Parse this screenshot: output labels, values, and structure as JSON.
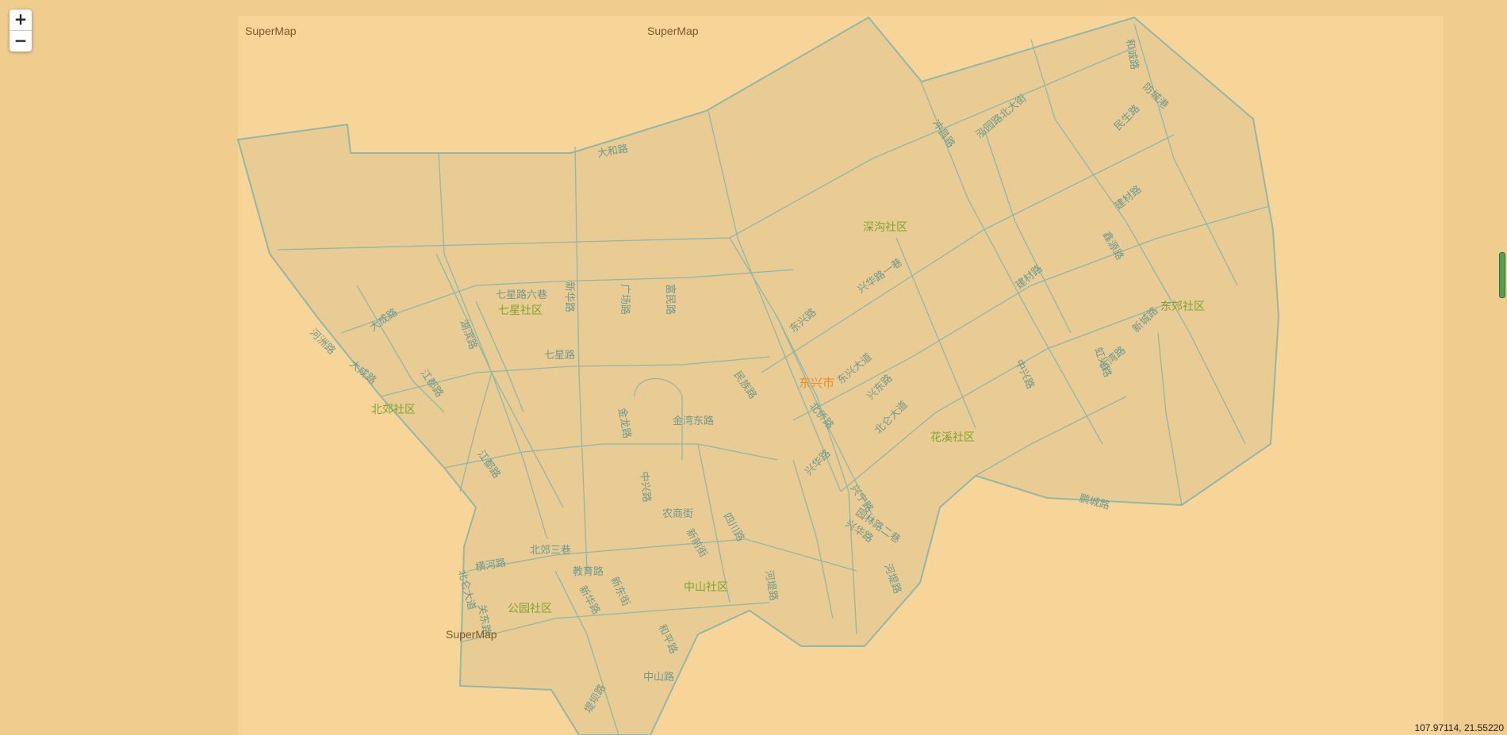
{
  "map": {
    "city": "东兴市",
    "coordinates": "107.97114, 21.55220",
    "watermarks": [
      "SuperMap",
      "SuperMap",
      "SuperMap"
    ],
    "zoom": {
      "in": "+",
      "out": "−"
    },
    "colors": {
      "background": "#f1cc8f",
      "tiles": "#f7d598",
      "land": "#e8cc93",
      "roads": "#8fb8a8",
      "road_label": "#6d9a8f",
      "district_label": "#7ea332",
      "city_label": "#f08a24"
    },
    "districts": [
      "深沟社区",
      "七星社区",
      "东郊社区",
      "北郊社区",
      "花溪社区",
      "中山社区",
      "公园社区"
    ],
    "roads": [
      "和诚路",
      "防城港",
      "民生路",
      "冲昌路",
      "泓园路北大街",
      "大和路",
      "七星路六巷",
      "新华路",
      "广场路",
      "富民路",
      "兴华路一巷",
      "建材路",
      "鑫源路",
      "建材路",
      "河洲路",
      "大成路",
      "湖滨路",
      "七星路",
      "大成路",
      "江都路",
      "东兴路",
      "东兴大道",
      "兴东路",
      "民族路",
      "金龙路",
      "金湾东路",
      "北侨路",
      "北仑大道",
      "兴华路",
      "中兴路",
      "虹兴路",
      "新城路",
      "江都路",
      "兴宁路",
      "农商街",
      "中兴路",
      "新前街",
      "园林路二巷",
      "四川路",
      "兴华路",
      "北郊三巷",
      "横河路",
      "教育路",
      "新东街",
      "新华路",
      "中山社区",
      "北仑大道",
      "关东路",
      "河堤路",
      "和平路",
      "中山路",
      "堤坝路",
      "河堤路",
      "鹏城路",
      "金湾路"
    ]
  }
}
